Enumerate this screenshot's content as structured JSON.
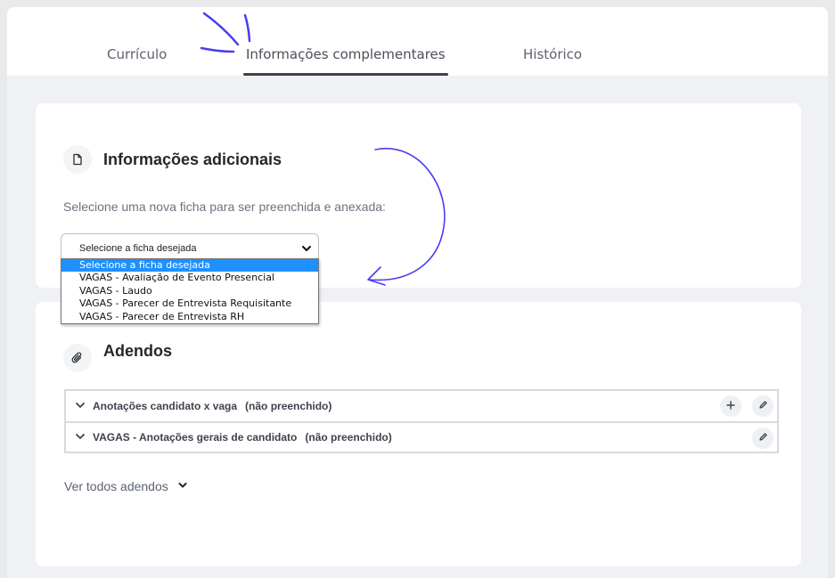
{
  "tabs": [
    {
      "label": "Currículo"
    },
    {
      "label": "Informações complementares"
    },
    {
      "label": "Histórico"
    }
  ],
  "info_section": {
    "title": "Informações adicionais",
    "hint": "Selecione uma nova ficha para ser preenchida e anexada:",
    "select_value": "Selecione a ficha desejada",
    "options": [
      "Selecione a ficha desejada",
      "VAGAS - Avaliação de Evento Presencial",
      "VAGAS - Laudo",
      "VAGAS - Parecer de Entrevista Requisitante",
      "VAGAS - Parecer de Entrevista RH"
    ]
  },
  "addenda_section": {
    "title": "Adendos",
    "items": [
      {
        "name": "Anotações candidato x vaga",
        "status": "(não preenchido)"
      },
      {
        "name": "VAGAS - Anotações gerais de candidato",
        "status": "(não preenchido)"
      }
    ],
    "see_all": "Ver todos adendos"
  },
  "colors": {
    "accent_selected": "#1e90ff",
    "annotation": "#4a3df0"
  },
  "icons": [
    "document-icon",
    "paperclip-icon",
    "chevron-down-icon",
    "plus-icon",
    "pencil-icon"
  ]
}
